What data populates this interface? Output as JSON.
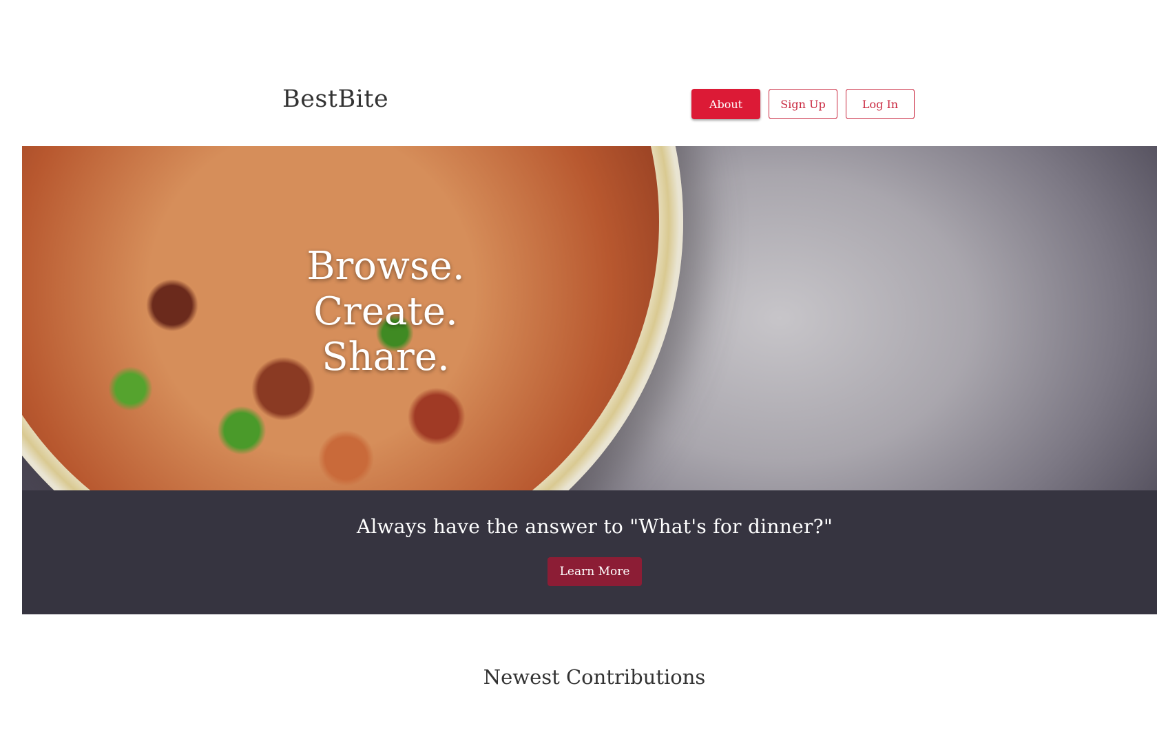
{
  "header": {
    "logo": "BestBite",
    "nav": {
      "about": "About",
      "sign_up": "Sign Up",
      "log_in": "Log In"
    }
  },
  "hero": {
    "lines": [
      "Browse.",
      "Create.",
      "Share."
    ]
  },
  "banner": {
    "tagline": "Always have the answer to \"What's for dinner?\"",
    "cta": "Learn More"
  },
  "contributions": {
    "title": "Newest Contributions"
  },
  "colors": {
    "accent": "#dc1a36",
    "banner_bg": "#363440",
    "cta_bg": "#8c1d35"
  }
}
